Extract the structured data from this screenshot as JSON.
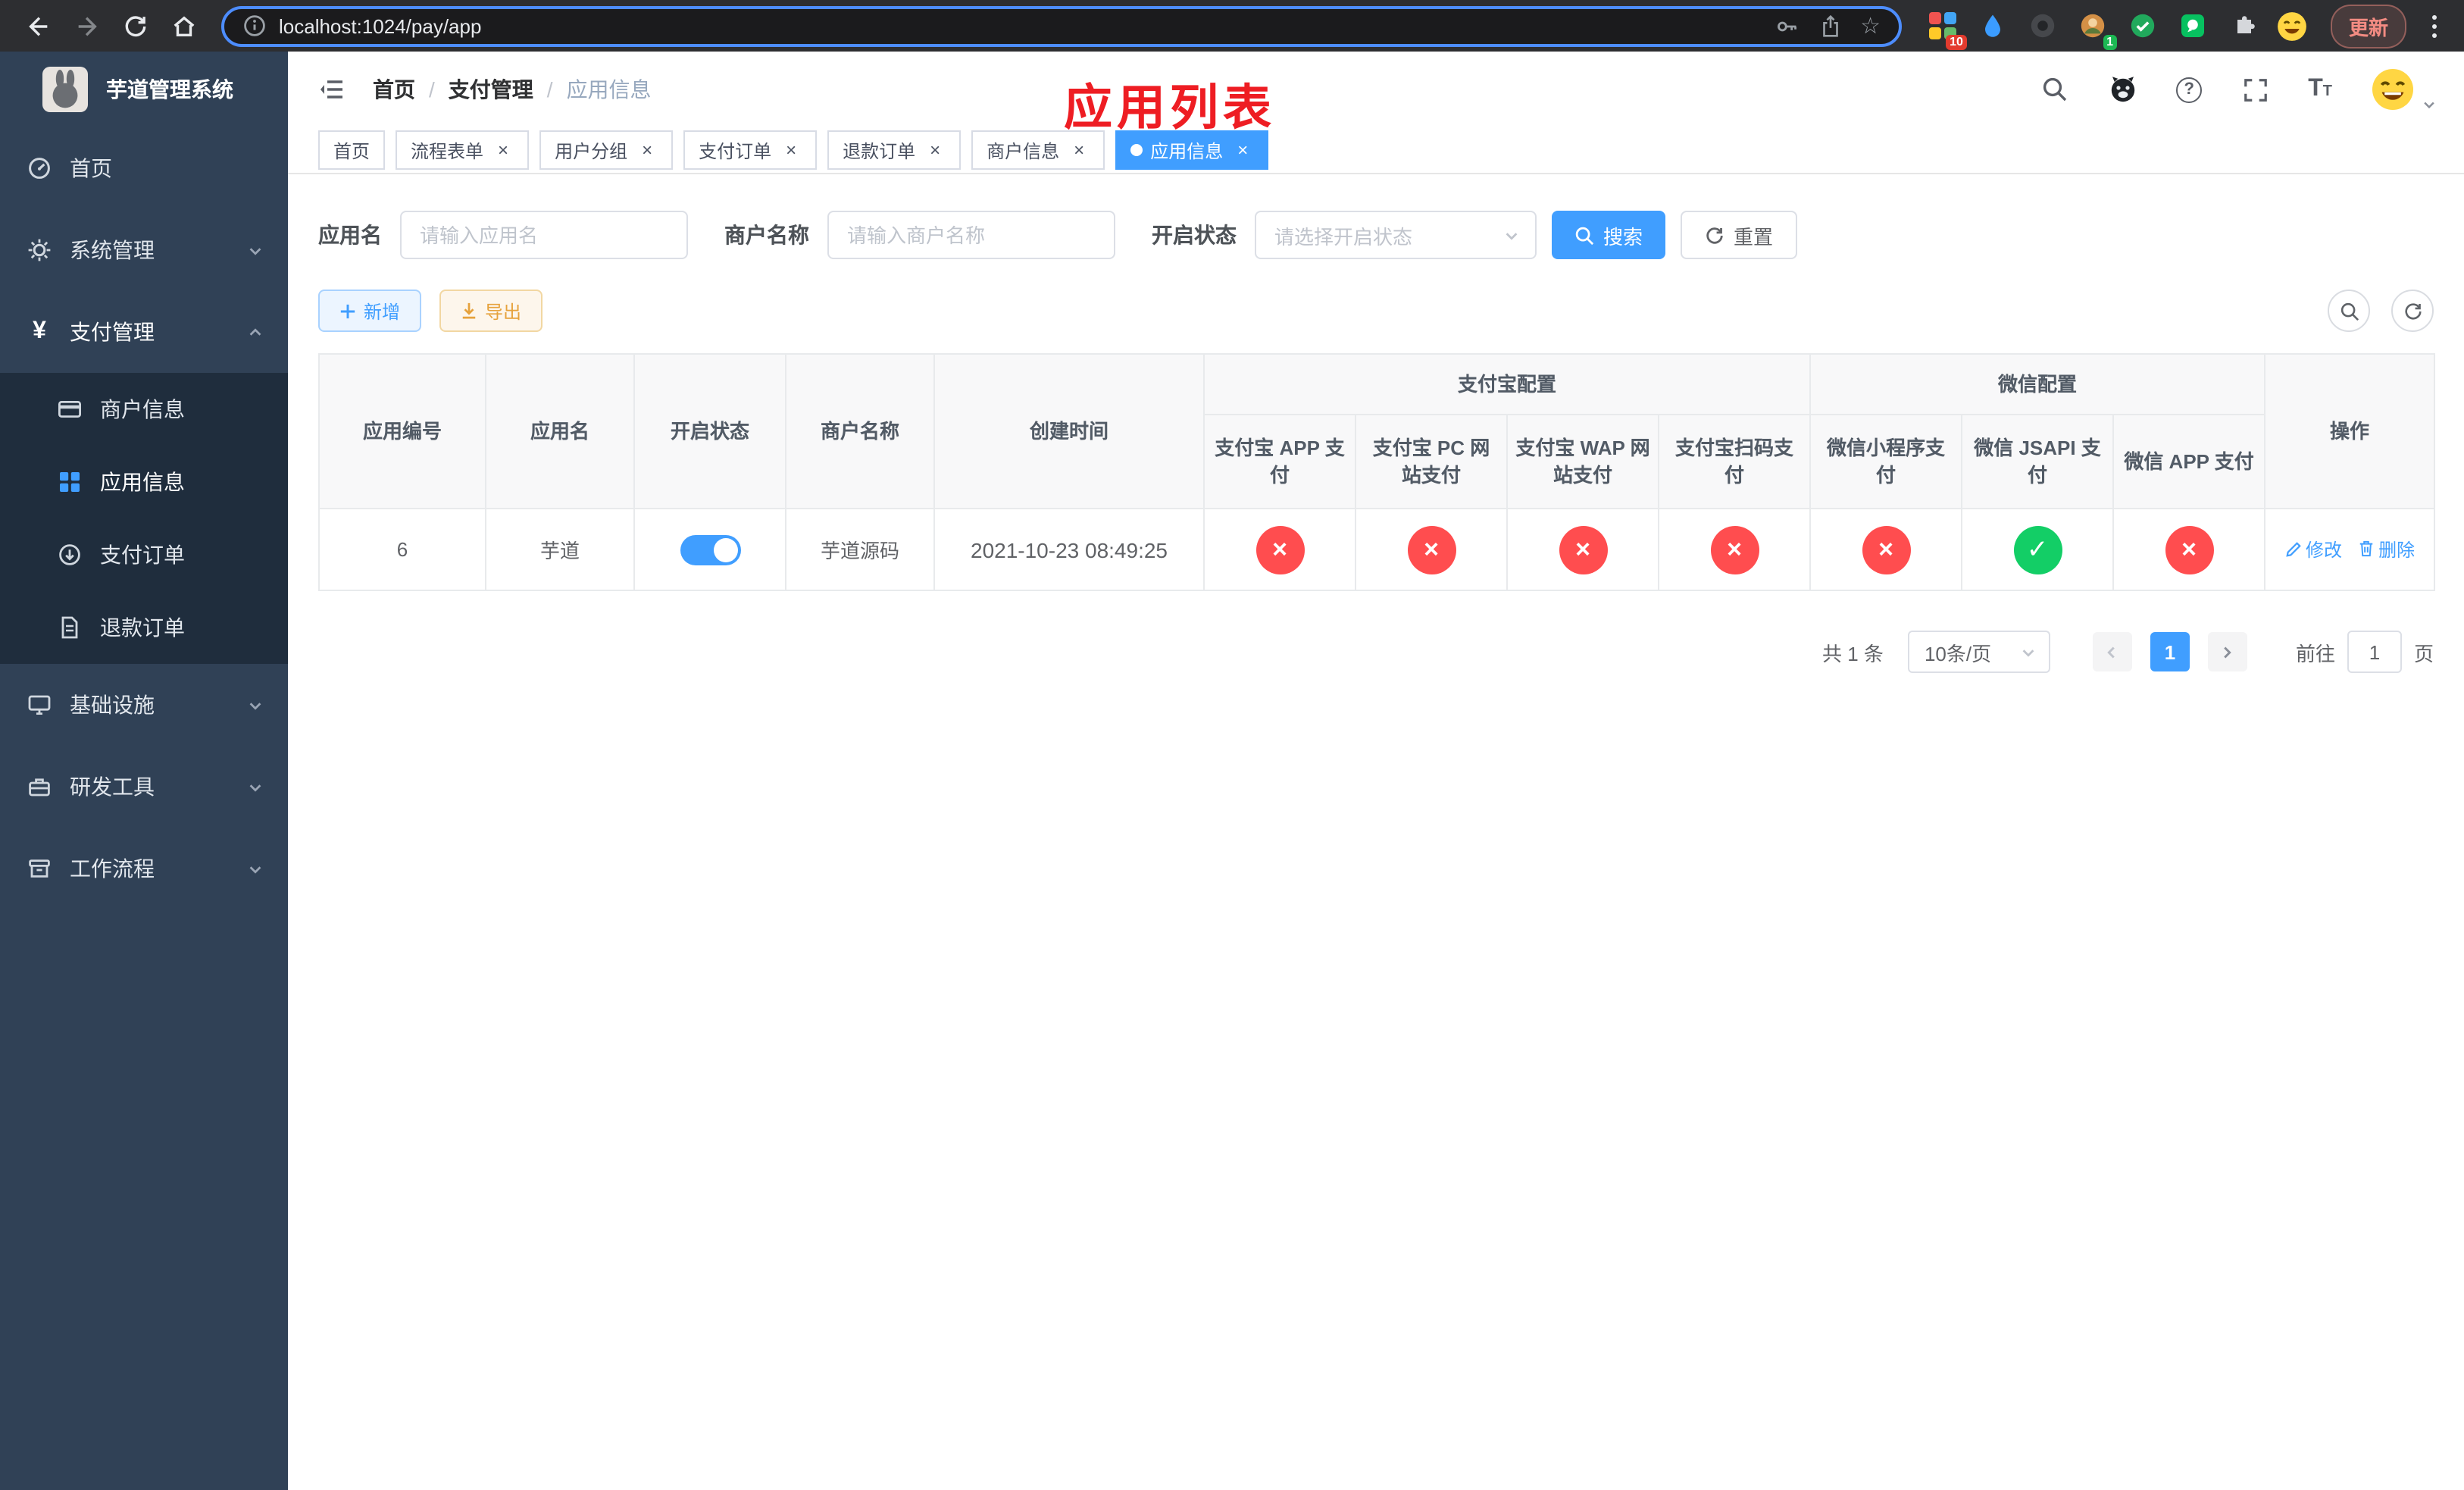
{
  "browser": {
    "url": "localhost:1024/pay/app",
    "update_label": "更新",
    "grid_ext_badge": "10",
    "avatar_ext_badge": "1"
  },
  "sidebar": {
    "title": "芋道管理系统",
    "items": [
      {
        "label": "首页"
      },
      {
        "label": "系统管理"
      },
      {
        "label": "支付管理"
      },
      {
        "label": "基础设施"
      },
      {
        "label": "研发工具"
      },
      {
        "label": "工作流程"
      }
    ],
    "submenu": [
      {
        "label": "商户信息"
      },
      {
        "label": "应用信息"
      },
      {
        "label": "支付订单"
      },
      {
        "label": "退款订单"
      }
    ]
  },
  "header": {
    "breadcrumb": [
      "首页",
      "支付管理",
      "应用信息"
    ],
    "sep": "/",
    "overlay_title": "应用列表"
  },
  "tabs": [
    {
      "label": "首页"
    },
    {
      "label": "流程表单"
    },
    {
      "label": "用户分组"
    },
    {
      "label": "支付订单"
    },
    {
      "label": "退款订单"
    },
    {
      "label": "商户信息"
    },
    {
      "label": "应用信息"
    }
  ],
  "filters": {
    "app_name_label": "应用名",
    "app_name_placeholder": "请输入应用名",
    "merchant_label": "商户名称",
    "merchant_placeholder": "请输入商户名称",
    "status_label": "开启状态",
    "status_placeholder": "请选择开启状态",
    "search_button": "搜索",
    "reset_button": "重置"
  },
  "toolbar": {
    "add_button": "新增",
    "export_button": "导出"
  },
  "table": {
    "group_alipay": "支付宝配置",
    "group_wechat": "微信配置",
    "columns": {
      "app_id": "应用编号",
      "app_name": "应用名",
      "status": "开启状态",
      "merchant": "商户名称",
      "created": "创建时间",
      "alipay_app": "支付宝 APP 支付",
      "alipay_pc": "支付宝 PC 网站支付",
      "alipay_wap": "支付宝 WAP 网站支付",
      "alipay_qr": "支付宝扫码支付",
      "wechat_mini": "微信小程序支付",
      "wechat_jsapi": "微信 JSAPI 支付",
      "wechat_app": "微信 APP 支付",
      "actions": "操作"
    },
    "row": {
      "app_id": "6",
      "app_name": "芋道",
      "enabled": true,
      "merchant": "芋道源码",
      "created": "2021-10-23 08:49:25",
      "alipay_app": false,
      "alipay_pc": false,
      "alipay_wap": false,
      "alipay_qr": false,
      "wechat_mini": false,
      "wechat_jsapi": true,
      "wechat_app": false,
      "edit_label": "修改",
      "delete_label": "删除"
    }
  },
  "pagination": {
    "total": "共 1 条",
    "page_size": "10条/页",
    "page": "1",
    "goto_label": "前往",
    "goto_value": "1",
    "unit_label": "页"
  },
  "colors": {
    "accent": "#409eff",
    "success": "#13ce66",
    "danger": "#ff4d4f",
    "sidebar_bg": "#304156",
    "submenu_bg": "#1f2d3d",
    "overlay_red": "#ee1d23"
  }
}
